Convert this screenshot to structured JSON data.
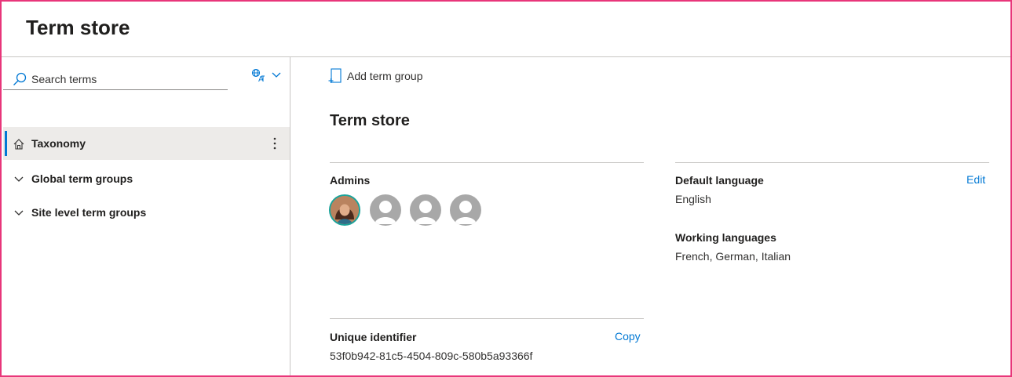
{
  "header": {
    "title": "Term store"
  },
  "left_pane": {
    "search": {
      "placeholder": "Search terms",
      "icon": "search-icon"
    },
    "language_picker": {
      "icon": "language-translate-icon",
      "chevron": "chevron-down-icon"
    },
    "tree": [
      {
        "label": "Taxonomy",
        "icon": "home-icon",
        "selected": true,
        "more_icon": "more-vertical-icon"
      },
      {
        "label": "Global term groups",
        "icon": "chevron-down-icon",
        "selected": false
      },
      {
        "label": "Site level term groups",
        "icon": "chevron-down-icon",
        "selected": false
      }
    ]
  },
  "main": {
    "command_bar": {
      "add_term_group": "Add term group",
      "icon": "add-group-icon"
    },
    "title": "Term store",
    "admins": {
      "label": "Admins",
      "avatars": [
        "photo",
        "placeholder",
        "placeholder",
        "placeholder"
      ]
    },
    "default_language": {
      "label": "Default language",
      "value": "English",
      "action": "Edit"
    },
    "working_languages": {
      "label": "Working languages",
      "value": "French, German, Italian"
    },
    "unique_identifier": {
      "label": "Unique identifier",
      "value": "53f0b942-81c5-4504-809c-580b5a93366f",
      "action": "Copy"
    }
  },
  "colors": {
    "accent": "#0078d4",
    "frame_border": "#e8367a",
    "selected_bg": "#edebe9"
  }
}
